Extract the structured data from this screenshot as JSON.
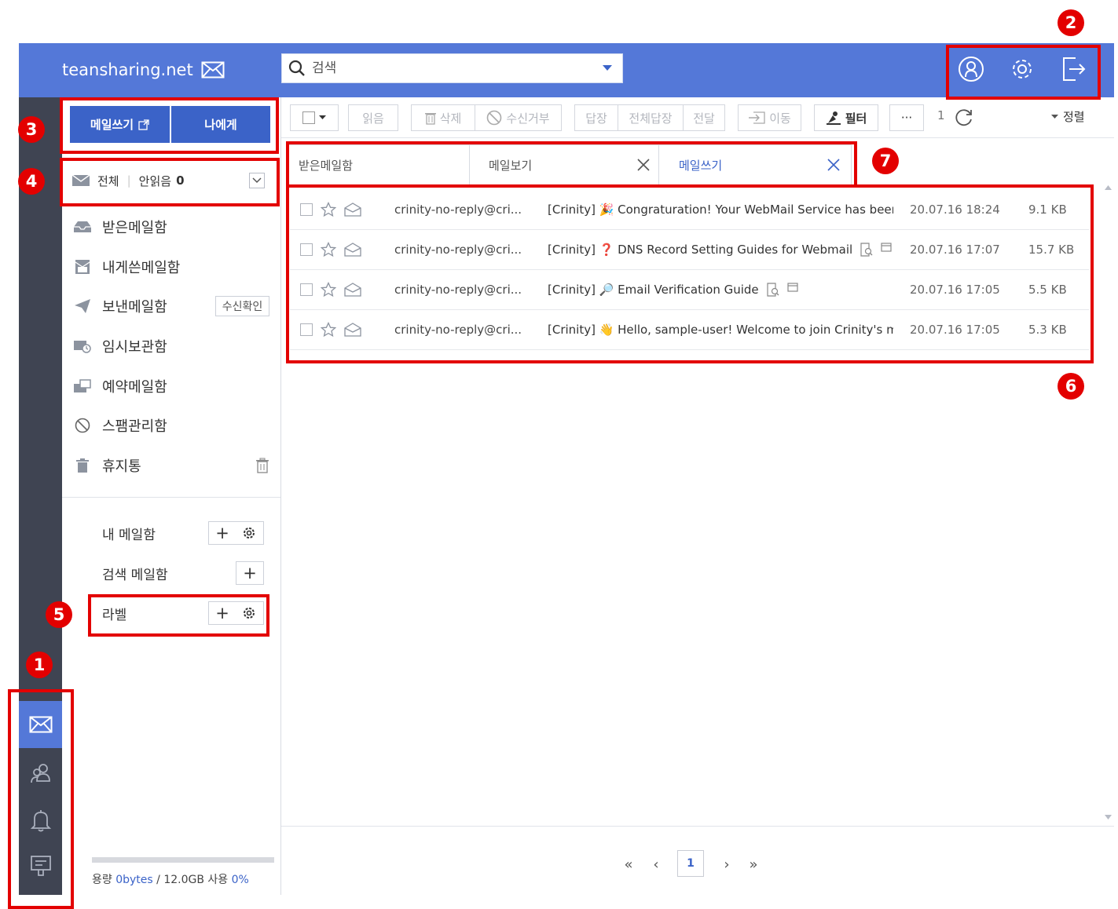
{
  "header": {
    "brand": "teansharing.net",
    "search_placeholder": "검색"
  },
  "compose": {
    "write_label": "메일쓰기",
    "to_me_label": "나에게"
  },
  "summary": {
    "all_label": "전체",
    "unread_label": "안읽음",
    "unread_count": "0"
  },
  "folders": [
    {
      "label": "받은메일함",
      "icon": "inbox-icon"
    },
    {
      "label": "내게쓴메일함",
      "icon": "self-mail-icon"
    },
    {
      "label": "보낸메일함",
      "icon": "send-icon",
      "badge": "수신확인"
    },
    {
      "label": "임시보관함",
      "icon": "draft-icon"
    },
    {
      "label": "예약메일함",
      "icon": "scheduled-icon"
    },
    {
      "label": "스팸관리함",
      "icon": "spam-icon"
    },
    {
      "label": "휴지통",
      "icon": "trash-icon"
    }
  ],
  "groups": {
    "my_mailbox": "내 메일함",
    "search_mailbox": "검색 메일함",
    "label": "라벨"
  },
  "quota": {
    "prefix": "용량",
    "used": "0bytes",
    "total": "/ 12.0GB 사용",
    "percent": "0%"
  },
  "toolbar": {
    "read": "읽음",
    "delete": "삭제",
    "block": "수신거부",
    "reply": "답장",
    "reply_all": "전체답장",
    "forward": "전달",
    "move": "이동",
    "filter": "필터",
    "more": "···",
    "page": "1",
    "sort": "정렬"
  },
  "tabs": [
    {
      "label": "받은메일함",
      "closable": false
    },
    {
      "label": "메일보기",
      "closable": true
    },
    {
      "label": "메일쓰기",
      "closable": true,
      "active": true
    }
  ],
  "mails": [
    {
      "from": "crinity-no-reply@cri...",
      "subject": "[Crinity] 🎉 Congraturation! Your WebMail Service has been act",
      "date": "20.07.16 18:24",
      "size": "9.1 KB",
      "attach": false
    },
    {
      "from": "crinity-no-reply@cri...",
      "subject": "[Crinity] ❓ DNS Record Setting Guides for Webmail",
      "date": "20.07.16 17:07",
      "size": "15.7 KB",
      "attach": true
    },
    {
      "from": "crinity-no-reply@cri...",
      "subject": "[Crinity] 🔎 Email Verification Guide",
      "date": "20.07.16 17:05",
      "size": "5.5 KB",
      "attach": true
    },
    {
      "from": "crinity-no-reply@cri...",
      "subject": "[Crinity] 👋 Hello, sample-user! Welcome to join Crinity's memb",
      "date": "20.07.16 17:05",
      "size": "5.3 KB",
      "attach": false
    }
  ],
  "pager": {
    "first": "«",
    "prev": "‹",
    "current": "1",
    "next": "›",
    "last": "»"
  },
  "annotations": [
    "1",
    "2",
    "3",
    "4",
    "5",
    "6",
    "7"
  ],
  "colors": {
    "header": "#5478d8",
    "rail": "#3f4452",
    "primary_button": "#3b63c8",
    "annotation_red": "#e30000"
  }
}
